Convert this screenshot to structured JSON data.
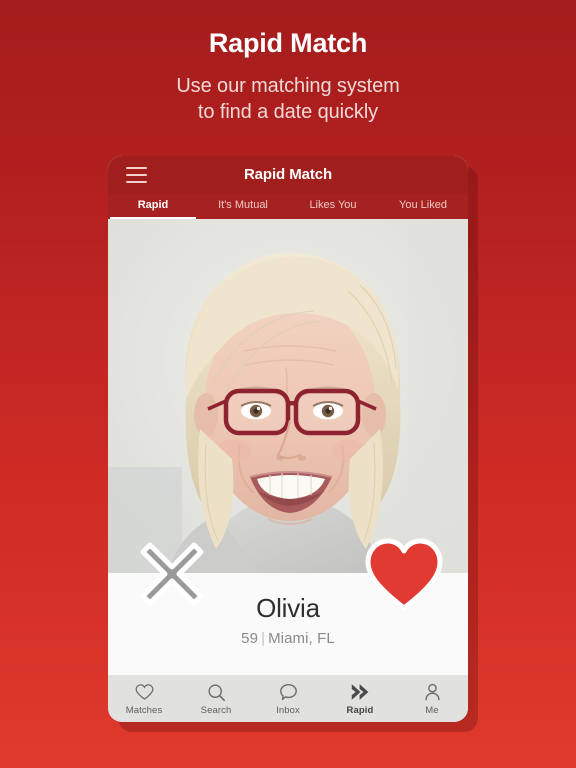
{
  "promo": {
    "title": "Rapid Match",
    "subtitle_line1": "Use our matching system",
    "subtitle_line2": "to find a date quickly"
  },
  "colors": {
    "background_top": "#a41c1c",
    "background_bottom": "#e03a2c",
    "appbar": "#a01f1c",
    "tabbar": "#a62220",
    "heart": "#e03a33",
    "dismiss": "#9a9a9a",
    "info_panel": "#fafafa",
    "bottom_nav": "#e1e1df"
  },
  "app": {
    "menu_icon": "hamburger-icon",
    "title": "Rapid Match",
    "tabs": [
      {
        "label": "Rapid",
        "active": true
      },
      {
        "label": "It's Mutual",
        "active": false
      },
      {
        "label": "Likes You",
        "active": false
      },
      {
        "label": "You Liked",
        "active": false
      }
    ]
  },
  "card": {
    "photo_alt": "smiling blonde woman with red eyeglasses",
    "dismiss_icon": "close-x-icon",
    "like_icon": "heart-icon",
    "name": "Olivia",
    "age": "59",
    "separator": "|",
    "location": "Miami, FL",
    "meta": "59 | Miami, FL"
  },
  "bottom_nav": [
    {
      "icon": "heart-outline-icon",
      "label": "Matches",
      "active": false
    },
    {
      "icon": "search-icon",
      "label": "Search",
      "active": false
    },
    {
      "icon": "chat-bubble-icon",
      "label": "Inbox",
      "active": false
    },
    {
      "icon": "double-chevron-right-icon",
      "label": "Rapid",
      "active": true
    },
    {
      "icon": "person-icon",
      "label": "Me",
      "active": false
    }
  ]
}
